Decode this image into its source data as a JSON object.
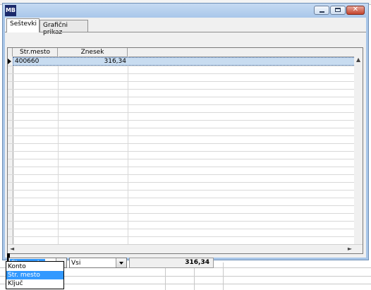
{
  "app": {
    "icon_text": "MB"
  },
  "tabs": [
    {
      "label": "Seštevki"
    },
    {
      "label": "Grafični prikaz"
    }
  ],
  "grid": {
    "columns": [
      "Str.mesto",
      "Znesek"
    ],
    "rows": [
      {
        "str_mesto": "400660",
        "znesek": "316,34"
      }
    ]
  },
  "filter": {
    "group_by_value": "Str. mesto",
    "scope_value": "Vsi",
    "total": "316,34",
    "group_by_options": [
      "Konto",
      "Str. mesto",
      "Ključ"
    ],
    "selected_option_index": 1
  },
  "colors": {
    "titlebar": "#a8c6e8",
    "selection": "#3399ff",
    "selected_row": "#c8dcf0"
  }
}
